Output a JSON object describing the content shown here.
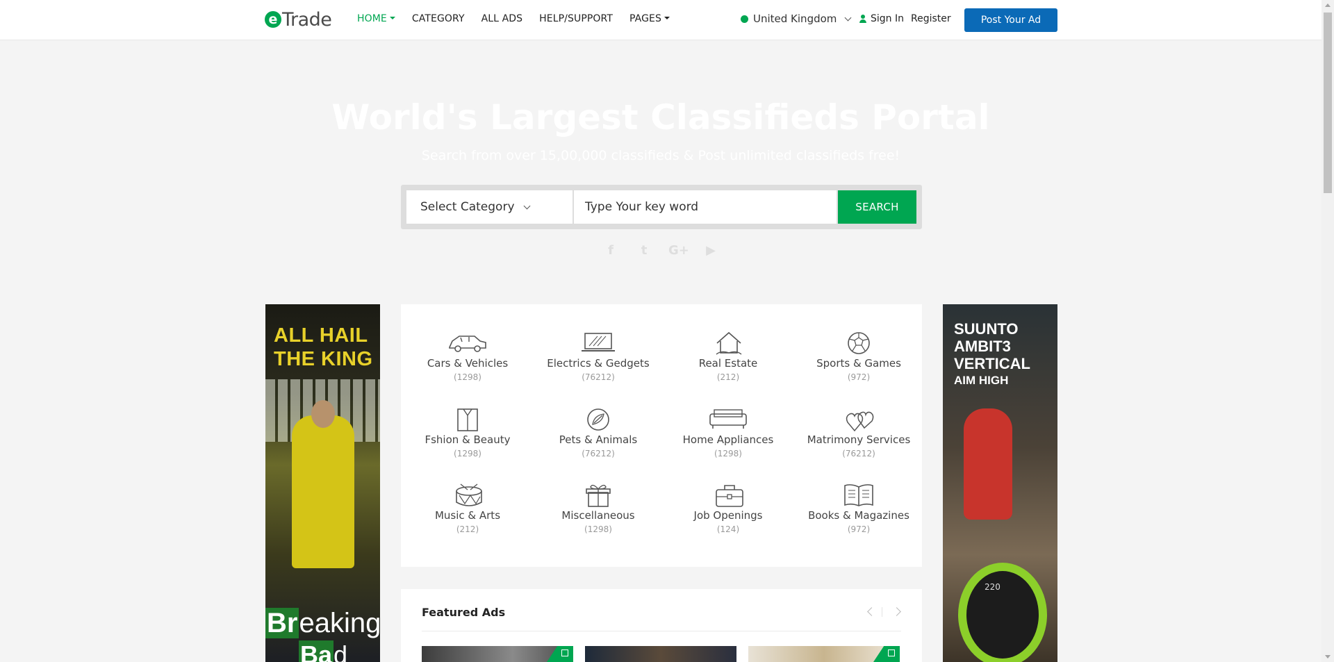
{
  "header": {
    "logo_letter": "e",
    "logo_text": "Trade",
    "nav": [
      {
        "label": "HOME",
        "active": true,
        "dropdown": true
      },
      {
        "label": "CATEGORY",
        "active": false,
        "dropdown": false
      },
      {
        "label": "ALL ADS",
        "active": false,
        "dropdown": false
      },
      {
        "label": "HELP/SUPPORT",
        "active": false,
        "dropdown": false
      },
      {
        "label": "PAGES",
        "active": false,
        "dropdown": true
      }
    ],
    "country": "United Kingdom",
    "signin": "Sign In",
    "register": "Register",
    "post_ad": "Post Your Ad"
  },
  "hero": {
    "title": "World's Largest Classifieds Portal",
    "subtitle": "Search from over 15,00,000 classifieds & Post unlimited classifieds free!"
  },
  "search": {
    "category_label": "Select Category",
    "keyword_placeholder": "Type Your key word",
    "button": "SEARCH"
  },
  "social": [
    "facebook-icon",
    "twitter-icon",
    "google-plus-icon",
    "youtube-icon"
  ],
  "social_glyphs": [
    "f",
    "t",
    "G+",
    "▶"
  ],
  "ads": {
    "left": {
      "line1": "ALL HAIL",
      "line2": "THE KING",
      "brand_a": "Br",
      "brand_a_rest": "eaking",
      "brand_b": "Ba",
      "brand_b_rest": "d"
    },
    "right": {
      "line1": "SUUNTO",
      "line2": "AMBIT3",
      "line3": "VERTICAL",
      "line4": "AIM HIGH",
      "watch_readout": "220"
    }
  },
  "categories": [
    {
      "name": "Cars & Vehicles",
      "count": "(1298)",
      "icon": "car-icon"
    },
    {
      "name": "Electrics & Gedgets",
      "count": "(76212)",
      "icon": "laptop-icon"
    },
    {
      "name": "Real Estate",
      "count": "(212)",
      "icon": "house-icon"
    },
    {
      "name": "Sports & Games",
      "count": "(972)",
      "icon": "football-icon"
    },
    {
      "name": "Fshion & Beauty",
      "count": "(1298)",
      "icon": "shirt-icon"
    },
    {
      "name": "Pets & Animals",
      "count": "(76212)",
      "icon": "pet-icon"
    },
    {
      "name": "Home Appliances",
      "count": "(1298)",
      "icon": "sofa-icon"
    },
    {
      "name": "Matrimony Services",
      "count": "(76212)",
      "icon": "hearts-icon"
    },
    {
      "name": "Music & Arts",
      "count": "(212)",
      "icon": "drum-icon"
    },
    {
      "name": "Miscellaneous",
      "count": "(1298)",
      "icon": "gift-icon"
    },
    {
      "name": "Job Openings",
      "count": "(124)",
      "icon": "briefcase-icon"
    },
    {
      "name": "Books & Magazines",
      "count": "(972)",
      "icon": "book-icon"
    }
  ],
  "featured": {
    "title": "Featured Ads"
  },
  "colors": {
    "accent": "#00a651",
    "post_button": "#0b6ab7"
  }
}
